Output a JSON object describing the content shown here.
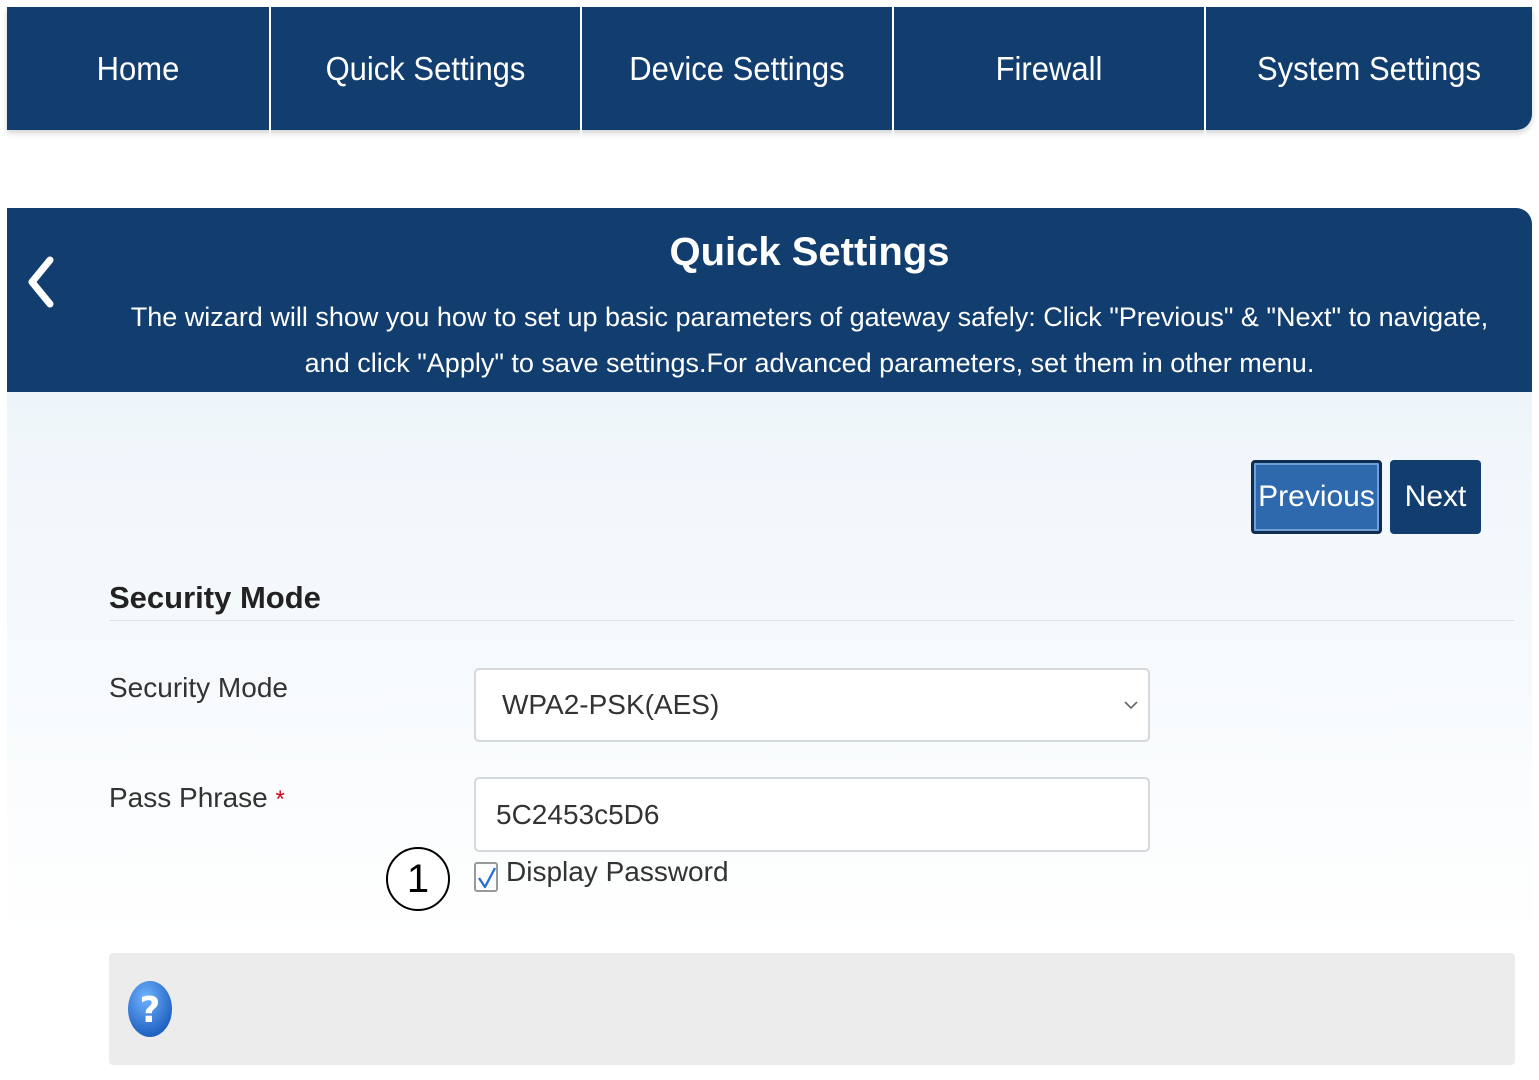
{
  "nav": {
    "items": [
      {
        "label": "Home"
      },
      {
        "label": "Quick Settings"
      },
      {
        "label": "Device Settings"
      },
      {
        "label": "Firewall"
      },
      {
        "label": "System Settings"
      }
    ]
  },
  "banner": {
    "title": "Quick Settings",
    "description": "The wizard will show you how to set up basic parameters of gateway safely: Click \"Previous\" & \"Next\" to navigate, and click \"Apply\" to save settings.For advanced parameters, set them in other menu."
  },
  "wizard": {
    "previous_label": "Previous",
    "next_label": "Next"
  },
  "section": {
    "title": "Security Mode"
  },
  "form": {
    "security_mode_label": "Security Mode",
    "security_mode_value": "WPA2-PSK(AES)",
    "pass_phrase_label": "Pass Phrase",
    "required_mark": "*",
    "pass_phrase_value": "5C2453c5D6",
    "display_password_label": "Display Password",
    "display_password_checked": true
  },
  "annotation": {
    "marker_number": "1"
  },
  "colors": {
    "primary": "#123d6f",
    "button_active": "#2e69ad",
    "required": "#d0021b",
    "check": "#2a6fd6"
  },
  "icons": {
    "back": "chevron-left-icon",
    "dropdown": "chevron-down-icon",
    "check": "checkmark-icon",
    "help": "question-mark-icon"
  }
}
